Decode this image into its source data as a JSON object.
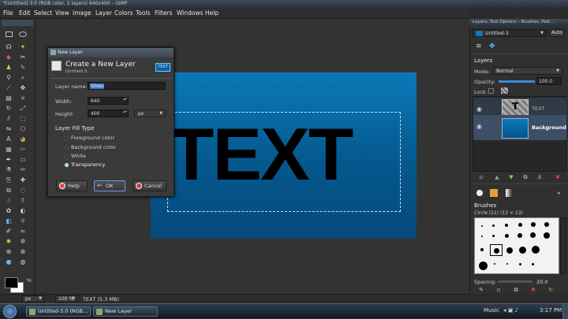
{
  "window": {
    "title": "*[Untitled]-3.0 (RGB color, 2 layers) 640x400 – GIMP"
  },
  "menu": [
    "File",
    "Edit",
    "Select",
    "View",
    "Image",
    "Layer",
    "Colors",
    "Tools",
    "Filters",
    "Windows",
    "Help"
  ],
  "canvas": {
    "text": "TEXT"
  },
  "dialog": {
    "window_title": "New Layer",
    "heading": "Create a New Layer",
    "subheading": "Untitled-3",
    "badge": "TEXT",
    "layer_name_label": "Layer name:",
    "layer_name_value": "Gloss",
    "width_label": "Width:",
    "width_value": "640",
    "height_label": "Height:",
    "height_value": "400",
    "unit": "px",
    "fill_heading": "Layer Fill Type",
    "fill_options": [
      "Foreground color",
      "Background color",
      "White",
      "Transparency"
    ],
    "selected_fill": "Transparency",
    "help_label": "Help",
    "ok_label": "OK",
    "cancel_label": "Cancel"
  },
  "right_panel": {
    "title": "Layers, Tool Options – Brushes, Patt...",
    "image_selector": "Untitled-3",
    "auto_label": "Auto",
    "layers_heading": "Layers",
    "mode_label": "Mode:",
    "mode_value": "Normal",
    "opacity_label": "Opacity:",
    "opacity_value": "100.0",
    "lock_label": "Lock:",
    "layers": [
      {
        "name": "TEXT"
      },
      {
        "name": "Background"
      }
    ],
    "brushes_heading": "Brushes",
    "brush_name": "Circle (11) (13 × 13)",
    "spacing_label": "Spacing:",
    "spacing_value": "20.0"
  },
  "statusbar": {
    "unit": "px",
    "zoom": "100 %",
    "info": "TEXT (5.3 MB)"
  },
  "taskbar": {
    "items": [
      "Untitled-3.0 (RGB...",
      "New Layer"
    ],
    "music_label": "Music",
    "clock": "3:17 PM"
  },
  "colors": {
    "canvas_blue": "#0a79b8",
    "accent": "#4a90d9"
  }
}
